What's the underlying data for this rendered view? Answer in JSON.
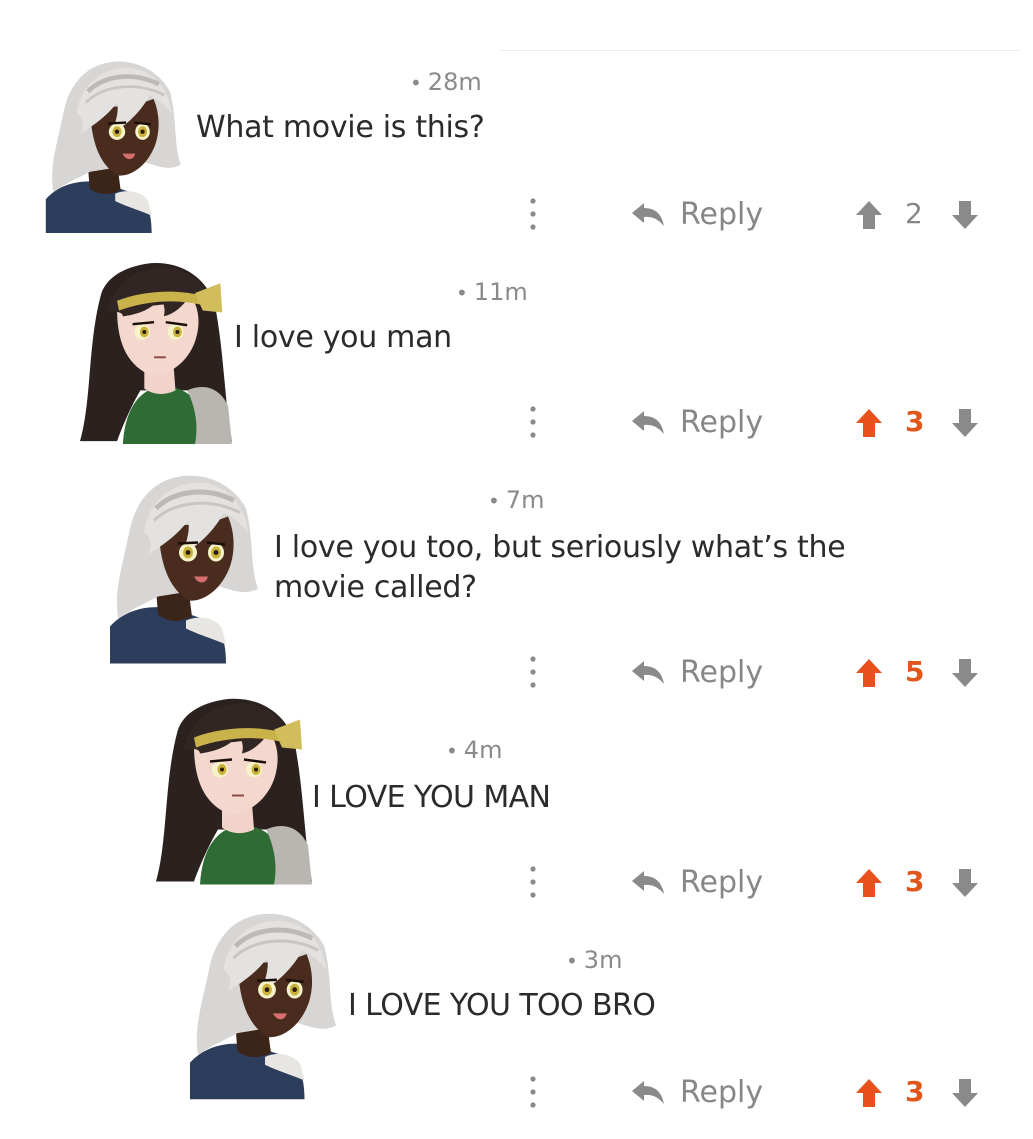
{
  "colors": {
    "upvote_active": "#E8501C",
    "icon_gray": "#8A8A8A",
    "text": "#2B2B2B",
    "meta": "#8A8A8A"
  },
  "reply_label": "Reply",
  "comments": [
    {
      "time": "28m",
      "text": "What movie is this?",
      "score": "2",
      "upvoted": false,
      "avatar": "white-haired-girl"
    },
    {
      "time": "11m",
      "text": "I love you man",
      "score": "3",
      "upvoted": true,
      "avatar": "dark-haired-girl"
    },
    {
      "time": "7m",
      "text": "I love you too, but seriously what’s the movie called?",
      "score": "5",
      "upvoted": true,
      "avatar": "white-haired-girl"
    },
    {
      "time": "4m",
      "text": "I LOVE YOU MAN",
      "score": "3",
      "upvoted": true,
      "avatar": "dark-haired-girl"
    },
    {
      "time": "3m",
      "text": "I LOVE YOU TOO BRO",
      "score": "3",
      "upvoted": true,
      "avatar": "white-haired-girl"
    }
  ],
  "icons": {
    "more": "more-vertical-icon",
    "reply": "reply-arrow-icon",
    "upvote": "arrow-up-icon",
    "downvote": "arrow-down-icon"
  }
}
